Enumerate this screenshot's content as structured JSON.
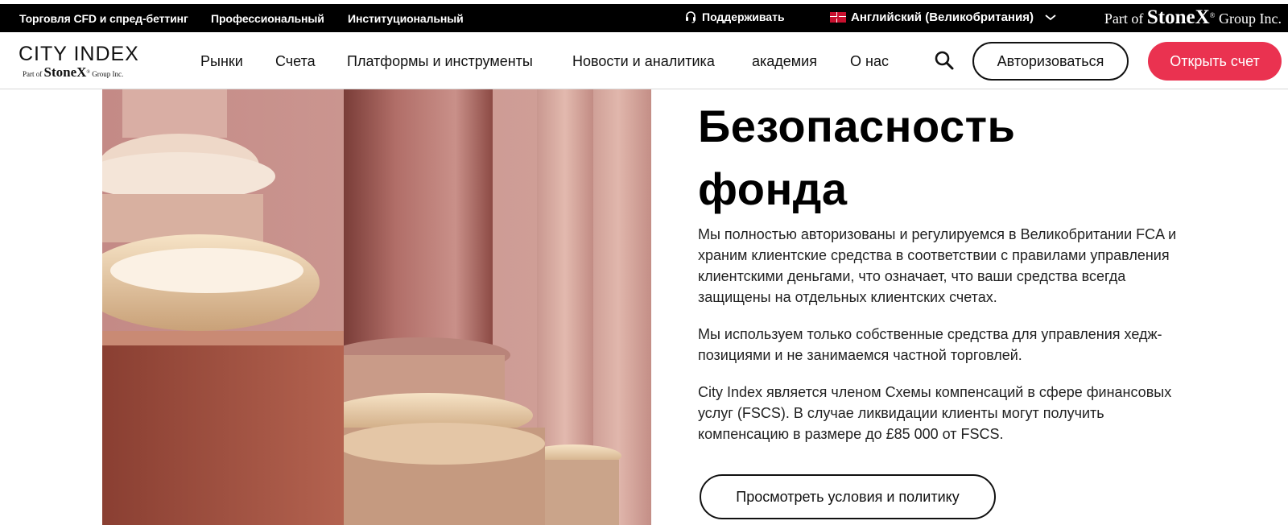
{
  "topbar": {
    "links": [
      "Торговля CFD и спред-беттинг",
      "Профессиональный",
      "Институциональный"
    ],
    "support_label": "Поддерживать",
    "language_label": "Английский (Великобритания)",
    "stonex": {
      "prefix": "Part of",
      "brand": "StoneX",
      "suffix": "Group Inc."
    }
  },
  "header": {
    "logo": {
      "title": "CITY INDEX",
      "sub_prefix": "Part of",
      "sub_brand": "StoneX",
      "sub_suffix": "Group Inc."
    },
    "nav": [
      "Рынки",
      "Счета",
      "Платформы и инструменты",
      "Новости и аналитика",
      "академия",
      "О нас"
    ],
    "login_label": "Авторизоваться",
    "open_account_label": "Открыть счет"
  },
  "hero": {
    "title_line1": "Безопасность",
    "title_line2": "фонда",
    "paragraphs": [
      "Мы полностью авторизованы и регулируемся в Великобритании FCA и храним клиентские средства в соответствии с правилами управления клиентскими деньгами, что означает, что ваши средства всегда защищены на отдельных клиентских счетах.",
      "Мы используем только собственные средства для управления хедж-позициями и не занимаемся частной торговлей.",
      "City Index является членом Схемы компенсаций в сфере финансовых услуг (FSCS). В случае ликвидации клиенты могут получить компенсацию в размере до £85 000 от FSCS."
    ],
    "terms_button_label": "Просмотреть условия и политику"
  },
  "colors": {
    "accent": "#ea3250",
    "topbar_bg": "#000000"
  },
  "icons": [
    "headset-icon",
    "uk-flag-icon",
    "chevron-down-icon",
    "search-icon"
  ]
}
